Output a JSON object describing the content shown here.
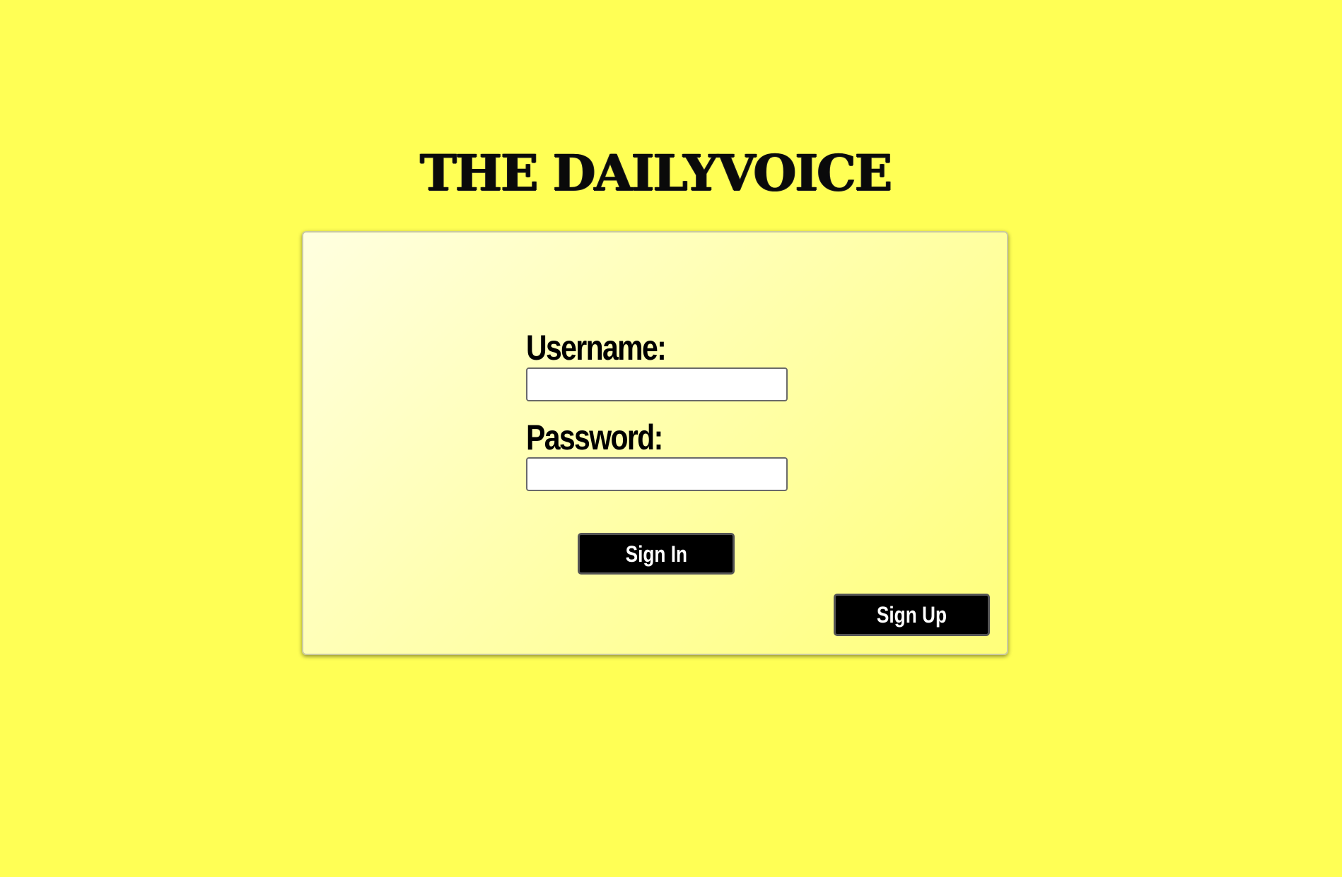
{
  "header": {
    "logo_text": "THE DAILYVOICE"
  },
  "login_form": {
    "username_label": "Username:",
    "username_value": "",
    "password_label": "Password:",
    "password_value": "",
    "sign_in_label": "Sign In",
    "sign_up_label": "Sign Up"
  },
  "colors": {
    "page_background": "#ffff55",
    "button_background": "#000000",
    "button_text": "#ffffff"
  }
}
